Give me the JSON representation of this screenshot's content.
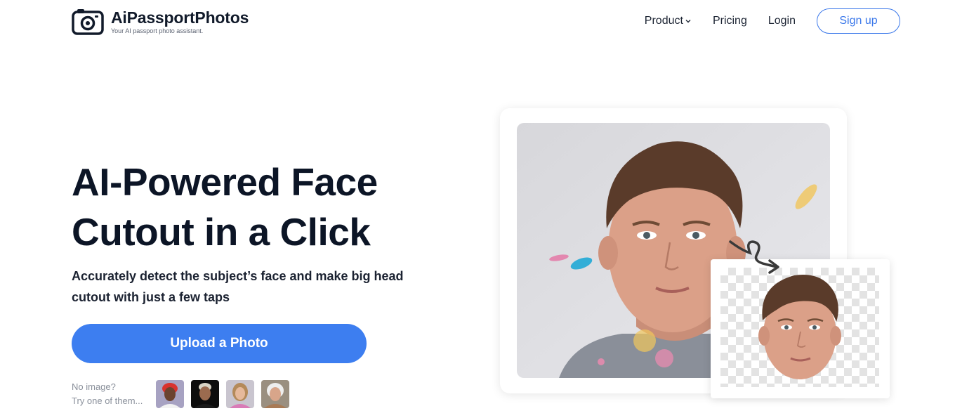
{
  "header": {
    "brand": "AiPassportPhotos",
    "tagline": "Your AI passport photo assistant.",
    "nav": {
      "product": "Product",
      "pricing": "Pricing",
      "login": "Login",
      "signup": "Sign up"
    }
  },
  "hero": {
    "title_line1": "AI-Powered Face",
    "title_line2": "Cutout in a Click",
    "subtitle_line1": "Accurately detect the subject’s face and make big head",
    "subtitle_line2": "cutout with just a few taps",
    "upload_label": "Upload a Photo",
    "samples_line1": "No image?",
    "samples_line2": "Try one of them..."
  },
  "colors": {
    "accent": "#3d7ef0",
    "text_dark": "#0c1526"
  }
}
